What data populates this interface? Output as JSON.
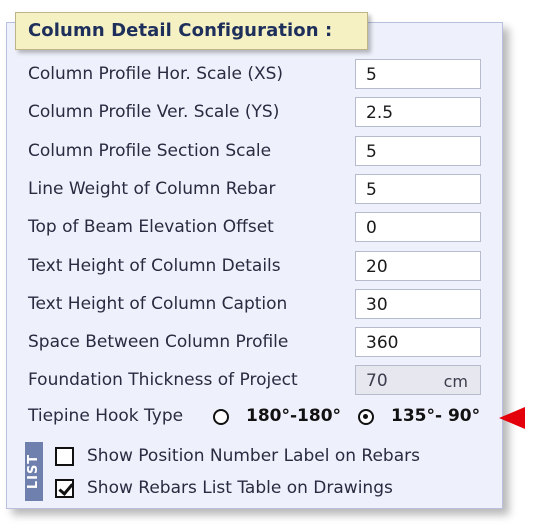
{
  "title": "Column Detail Configuration :",
  "fields": [
    {
      "label": "Column Profile Hor. Scale (XS)",
      "value": "5"
    },
    {
      "label": "Column Profile Ver. Scale (YS)",
      "value": "2.5"
    },
    {
      "label": "Column Profile Section Scale",
      "value": "5"
    },
    {
      "label": "Line Weight of Column Rebar",
      "value": "5"
    },
    {
      "label": "Top of Beam Elevation Offset",
      "value": "0"
    },
    {
      "label": "Text Height of Column Details",
      "value": "20"
    },
    {
      "label": "Text Height of Column Caption",
      "value": "30"
    },
    {
      "label": "Space Between Column Profile",
      "value": "360"
    },
    {
      "label": "Foundation Thickness of Project",
      "value": "70",
      "unit": "cm"
    }
  ],
  "hook": {
    "label": "Tiepine Hook Type",
    "options": [
      {
        "label": "180°-180°",
        "selected": false
      },
      {
        "label": "135°- 90°",
        "selected": true
      }
    ]
  },
  "list_tag": "LIST",
  "checkboxes": [
    {
      "label": "Show Position Number Label on Rebars",
      "checked": false
    },
    {
      "label": "Show Rebars List Table on Drawings",
      "checked": true
    }
  ],
  "colors": {
    "panel": "#eef0fb",
    "title_bg": "#f5f1c3",
    "title_text": "#1e2f5c",
    "arrow": "#e3000b",
    "list_tag": "#6f7fae"
  },
  "icons": {
    "arrow": "red-arrow-left-icon"
  }
}
